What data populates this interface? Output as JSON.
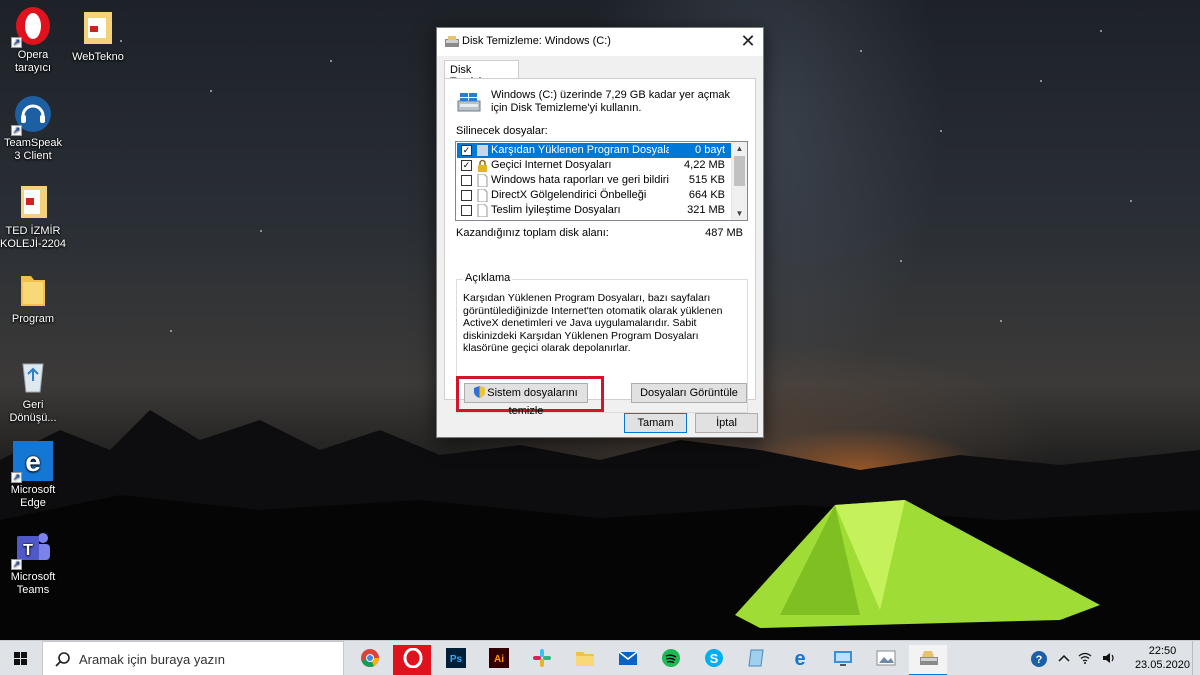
{
  "desktop": {
    "icons": [
      {
        "label": "Opera tarayıcı",
        "icon": "opera-icon"
      },
      {
        "label": "WebTekno",
        "icon": "folder-icon"
      },
      {
        "label": "TeamSpeak 3 Client",
        "icon": "teamspeak-icon"
      },
      {
        "label": "TED İZMİR KOLEJİ-2204",
        "icon": "folder-icon"
      },
      {
        "label": "Program",
        "icon": "folder-icon"
      },
      {
        "label": "Geri Dönüşü...",
        "icon": "recycle-bin-icon"
      },
      {
        "label": "Microsoft Edge",
        "icon": "edge-icon"
      },
      {
        "label": "Microsoft Teams",
        "icon": "teams-icon"
      }
    ]
  },
  "dialog": {
    "title": "Disk Temizleme:  Windows (C:)",
    "tab": "Disk Temizleme",
    "intro": "Windows (C:) üzerinde 7,29 GB kadar yer açmak için Disk Temizleme'yi kullanın.",
    "files_label": "Silinecek dosyalar:",
    "files": [
      {
        "name": "Karşıdan Yüklenen Program Dosyaları",
        "size": "0 bayt",
        "checked": true,
        "selected": true
      },
      {
        "name": "Geçici Internet Dosyaları",
        "size": "4,22 MB",
        "checked": true,
        "selected": false
      },
      {
        "name": "Windows hata raporları ve geri bildirim t...",
        "size": "515 KB",
        "checked": false,
        "selected": false
      },
      {
        "name": "DirectX Gölgelendirici Önbelleği",
        "size": "664 KB",
        "checked": false,
        "selected": false
      },
      {
        "name": "Teslim İyileştime Dosyaları",
        "size": "321 MB",
        "checked": false,
        "selected": false
      }
    ],
    "total_label": "Kazandığınız toplam disk alanı:",
    "total_value": "487 MB",
    "description_title": "Açıklama",
    "description": "Karşıdan Yüklenen Program Dosyaları, bazı sayfaları görüntülediğinizde Internet'ten otomatik olarak yüklenen ActiveX denetimleri ve Java uygulamalarıdır. Sabit diskinizdeki Karşıdan Yüklenen Program Dosyaları klasörüne geçici olarak depolanırlar.",
    "clean_system_button": "Sistem dosyalarını temizle",
    "view_files_button": "Dosyaları Görüntüle",
    "ok_button": "Tamam",
    "cancel_button": "İptal",
    "close_symbol": "✕"
  },
  "taskbar": {
    "search_placeholder": "Aramak için buraya yazın",
    "apps": [
      "chrome-icon",
      "opera-icon",
      "photoshop-icon",
      "illustrator-icon",
      "slack-icon",
      "file-explorer-icon",
      "mail-icon",
      "spotify-icon",
      "skype-icon",
      "notepad-icon",
      "edge-icon",
      "remote-desktop-icon",
      "photos-icon",
      "disk-cleanup-icon"
    ],
    "photoshop_text": "Ps",
    "illustrator_text": "Ai",
    "skype_text": "S",
    "time": "22:50",
    "date": "23.05.2020"
  },
  "colors": {
    "accent": "#0078d7",
    "highlight_box": "#d4142a",
    "tent_green": "#a8e33a"
  }
}
